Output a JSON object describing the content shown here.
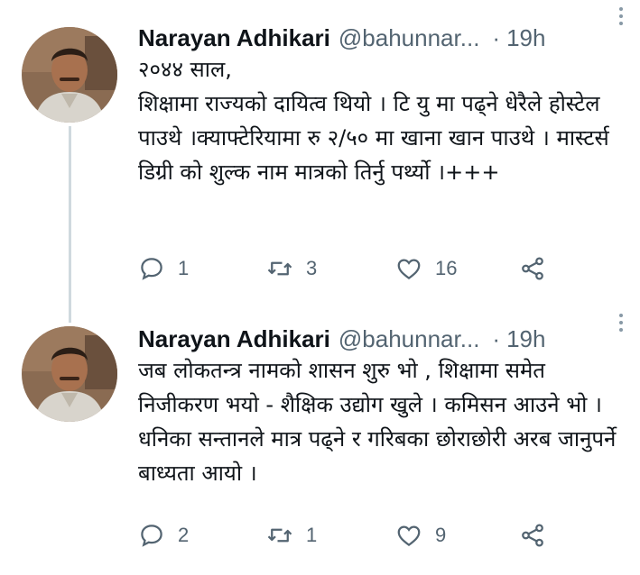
{
  "tweets": [
    {
      "author_name": "Narayan Adhikari",
      "handle": "@bahunnar...",
      "separator": "·",
      "time": "19h",
      "text": "२०४४ साल,\nशिक्षामा राज्यको दायित्व थियो । टि यु मा पढ्ने धेरैले होस्टेल पाउथे ।क्याफ्टेरियामा रु २/५० मा खाना खान पाउथे । मास्टर्स डिग्री को शुल्क नाम मात्रको तिर्नु पर्थ्यो ।+++",
      "replies": "1",
      "retweets": "3",
      "likes": "16"
    },
    {
      "author_name": "Narayan Adhikari",
      "handle": "@bahunnar...",
      "separator": "·",
      "time": "19h",
      "text": "जब लोकतन्त्र नामको शासन शुरु भो , शिक्षामा समेत निजीकरण भयो - शैक्षिक उद्योग खुले । कमिसन आउने भो ।धनिका सन्तानले मात्र पढ्ने र गरिबका छोराछोरी अरब जानुपर्ने बाध्यता आयो ।",
      "replies": "2",
      "retweets": "1",
      "likes": "9"
    }
  ],
  "colors": {
    "text": "#0f1419",
    "secondary": "#536471",
    "thread_line": "#cfd9de"
  },
  "icons": [
    "reply-icon",
    "retweet-icon",
    "like-icon",
    "share-icon",
    "more-icon"
  ]
}
